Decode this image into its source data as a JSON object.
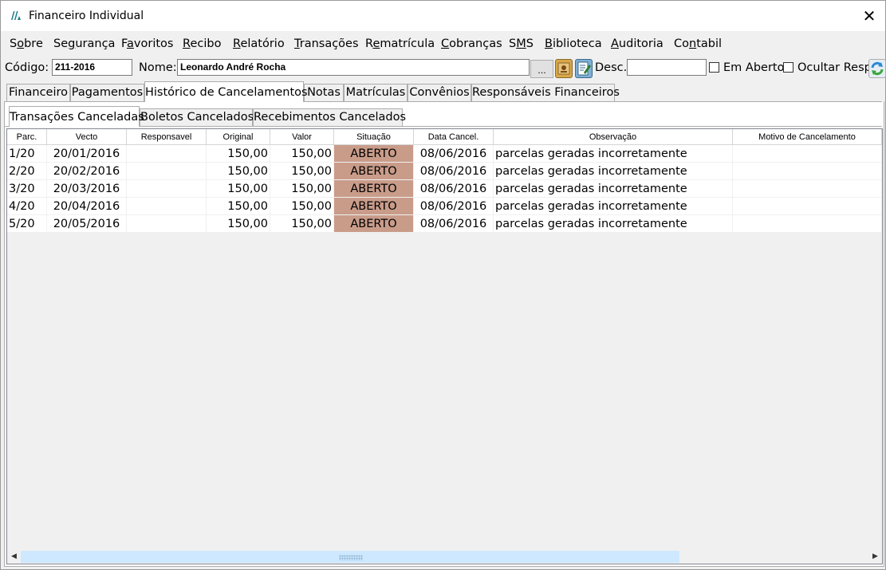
{
  "window": {
    "title": "Financeiro Individual",
    "close_glyph": "✕"
  },
  "menu": [
    {
      "pre": "S",
      "mn": "o",
      "post": "bre"
    },
    {
      "pre": "Se",
      "mn": "g",
      "post": "urança"
    },
    {
      "pre": "F",
      "mn": "a",
      "post": "voritos"
    },
    {
      "pre": "",
      "mn": "R",
      "post": "ecibo"
    },
    {
      "pre": "",
      "mn": "R",
      "post": "elatório"
    },
    {
      "pre": "",
      "mn": "T",
      "post": "ransações"
    },
    {
      "pre": "R",
      "mn": "e",
      "post": "matrícula"
    },
    {
      "pre": "",
      "mn": "C",
      "post": "obranças"
    },
    {
      "pre": "S",
      "mn": "M",
      "post": "S"
    },
    {
      "pre": "",
      "mn": "B",
      "post": "iblioteca"
    },
    {
      "pre": "",
      "mn": "A",
      "post": "uditoria"
    },
    {
      "pre": "Co",
      "mn": "n",
      "post": "tabil"
    }
  ],
  "fields": {
    "codigo_label": "Código:",
    "codigo_value": "211-2016",
    "nome_label": "Nome:",
    "nome_value": "Leonardo André Rocha",
    "dots_label": "...",
    "desc_label": "Desc.:",
    "desc_value": "",
    "em_aberto_label": "Em Aberto",
    "ocultar_label": "Ocultar Resp."
  },
  "icons": {
    "lookup": "id-card-icon",
    "edit": "edit-document-icon",
    "refresh": "refresh-icon"
  },
  "tabs_main": [
    "Financeiro",
    "Pagamentos",
    "Histórico de Cancelamentos",
    "Notas",
    "Matrículas",
    "Convênios",
    "Responsáveis Financeiros"
  ],
  "tabs_main_active": 2,
  "tabs_sub": [
    "Transações Canceladas",
    "Boletos Cancelados",
    "Recebimentos Cancelados"
  ],
  "tabs_sub_active": 0,
  "grid": {
    "columns": [
      "Parc.",
      "Vecto",
      "Responsavel",
      "Original",
      "Valor",
      "Situação",
      "Data Cancel.",
      "Observação",
      "Motivo de Cancelamento"
    ],
    "rows": [
      [
        "1/20",
        "20/01/2016",
        "",
        "150,00",
        "150,00",
        "ABERTO",
        "08/06/2016",
        "parcelas geradas incorretamente",
        ""
      ],
      [
        "2/20",
        "20/02/2016",
        "",
        "150,00",
        "150,00",
        "ABERTO",
        "08/06/2016",
        "parcelas geradas incorretamente",
        ""
      ],
      [
        "3/20",
        "20/03/2016",
        "",
        "150,00",
        "150,00",
        "ABERTO",
        "08/06/2016",
        "parcelas geradas incorretamente",
        ""
      ],
      [
        "4/20",
        "20/04/2016",
        "",
        "150,00",
        "150,00",
        "ABERTO",
        "08/06/2016",
        "parcelas geradas incorretamente",
        ""
      ],
      [
        "5/20",
        "20/05/2016",
        "",
        "150,00",
        "150,00",
        "ABERTO",
        "08/06/2016",
        "parcelas geradas incorretamente",
        ""
      ]
    ],
    "status_color": "#c99c8a"
  },
  "colors": {
    "app_icon": "#1a7a8a",
    "scroll_thumb": "#cde8ff"
  }
}
